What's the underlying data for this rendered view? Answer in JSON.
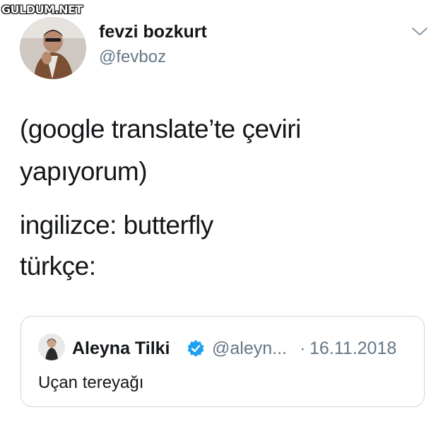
{
  "watermark": "GULDUM.NET",
  "tweet": {
    "author": {
      "name": "fevzi bozkurt",
      "handle": "@fevboz",
      "avatar_icon": "profile-photo"
    },
    "menu_icon": "chevron-down-icon",
    "text_lines": [
      "(google translate’te çeviri",
      "yapıyorum)",
      "ingilizce: butterfly",
      "türkçe:"
    ]
  },
  "quoted_tweet": {
    "name": "Aleyna Tilki",
    "verified_icon": "verified-badge-icon",
    "handle": "@aleyn...",
    "separator": "·",
    "date": "16.11.2018",
    "text": "Uçan tereyağı"
  },
  "colors": {
    "text": "#14171a",
    "secondary": "#657786",
    "verified": "#1da1f2",
    "border": "#ccd6dd"
  }
}
